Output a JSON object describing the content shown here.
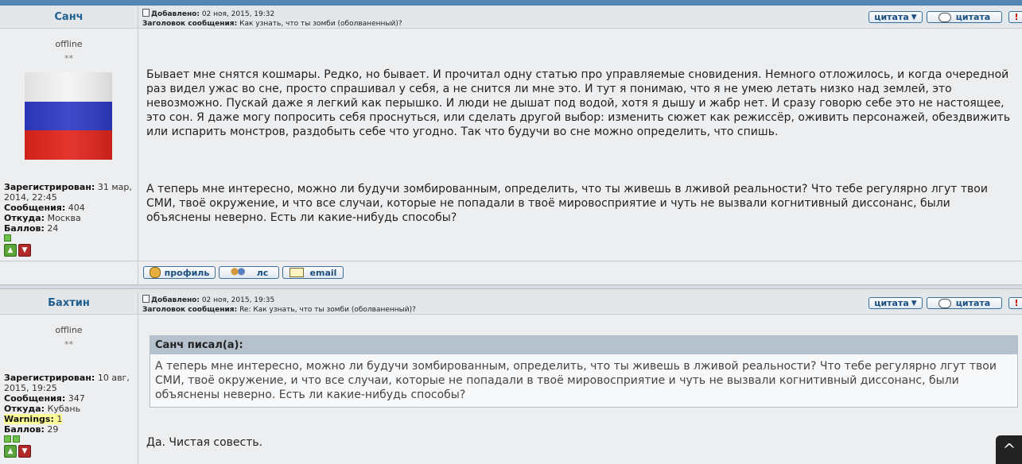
{
  "posts": [
    {
      "username": "Санч",
      "status": "offline",
      "stars": "**",
      "registered_label": "Зарегистрирован:",
      "registered_value": "31 мар, 2014, 22:45",
      "messages_label": "Сообщения:",
      "messages_value": "404",
      "from_label": "Откуда:",
      "from_value": "Москва",
      "points_label": "Баллов:",
      "points_value": "24",
      "added_label": "Добавлено:",
      "added_value": "02 ноя, 2015, 19:32",
      "subject_label": "Заголовок сообщения:",
      "subject_value": "Как узнать, что ты зомби (оболваненный)?",
      "text_p1": "Бывает мне снятся кошмары. Редко, но бывает. И прочитал одну статью про управляемые сновидения. Немного отложилось, и когда очередной раз видел ужас во сне, просто спрашивал у себя, а не снится ли мне это. И тут я понимаю, что я не умею летать низко над землей, это невозможно. Пускай даже я легкий как перышко. И люди не дышат под водой, хотя я дышу и жабр нет. И сразу говорю себе это не настоящее, это сон. Я даже могу попросить себя проснуться, или сделать другой выбор: изменить сюжет как режиссёр, оживить персонажей, обездвижить или испарить монстров, раздобыть себе что угодно. Так что будучи во сне можно определить, что спишь.",
      "text_p2": "А теперь мне интересно, можно ли будучи зомбированным, определить, что ты живешь в лживой реальности? Что тебе регулярно лгут твои СМИ, твоё окружение, и что все случаи, которые не попадали в твоё мировосприятие и чуть не вызвали когнитивный диссонанс, были объяснены неверно. Есть ли какие-нибудь способы?"
    },
    {
      "username": "Бахтин",
      "status": "offline",
      "stars": "**",
      "registered_label": "Зарегистрирован:",
      "registered_value": "10 авг, 2015, 19:25",
      "messages_label": "Сообщения:",
      "messages_value": "347",
      "from_label": "Откуда:",
      "from_value": "Кубань",
      "warnings_label": "Warnings:",
      "warnings_value": "1",
      "points_label": "Баллов:",
      "points_value": "29",
      "added_label": "Добавлено:",
      "added_value": "02 ноя, 2015, 19:35",
      "subject_label": "Заголовок сообщения:",
      "subject_value": "Re: Как узнать, что ты зомби (оболваненный)?",
      "quote_header": "Санч писал(а):",
      "quote_text": "А теперь мне интересно, можно ли будучи зомбированным, определить, что ты живешь в лживой реальности? Что тебе регулярно лгут твои СМИ, твоё окружение, и что все случаи, которые не попадали в твоё мировосприятие и чуть не вызвали когнитивный диссонанс, были объяснены неверно. Есть ли какие-нибудь способы?",
      "text": "Да. Чистая совесть."
    }
  ],
  "buttons": {
    "quote_select": "цитата",
    "quote": "цитата",
    "report": "!",
    "profile": "профиль",
    "pm": "лс",
    "email": "email"
  },
  "icons": {
    "vote_up": "thumb-up-icon",
    "vote_down": "thumb-down-icon"
  }
}
